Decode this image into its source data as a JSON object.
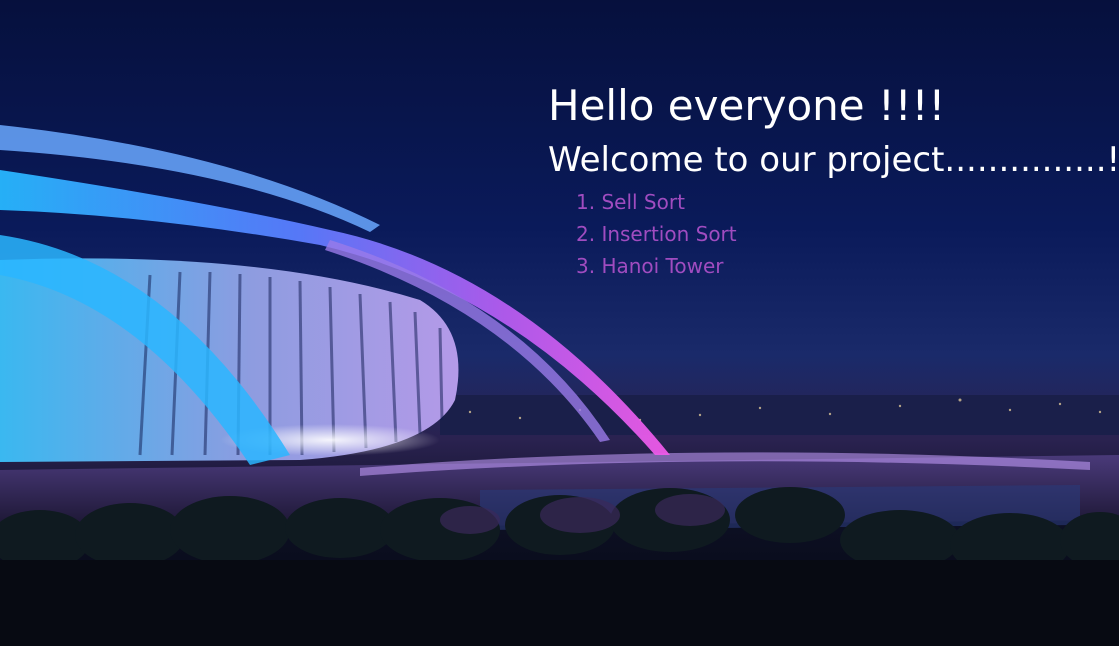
{
  "header": {
    "greeting": "Hello everyone !!!!",
    "welcome": "Welcome to our project...............!"
  },
  "menu": {
    "items": [
      {
        "label": "1. Sell Sort"
      },
      {
        "label": "2. Insertion Sort"
      },
      {
        "label": "3. Hanoi Tower"
      }
    ]
  },
  "colors": {
    "heading": "#ffffff",
    "menu_text": "#a04cc0",
    "sky": "#0a1a5a",
    "arc_cyan": "#2ab6ff",
    "arc_magenta": "#e04cf0"
  }
}
